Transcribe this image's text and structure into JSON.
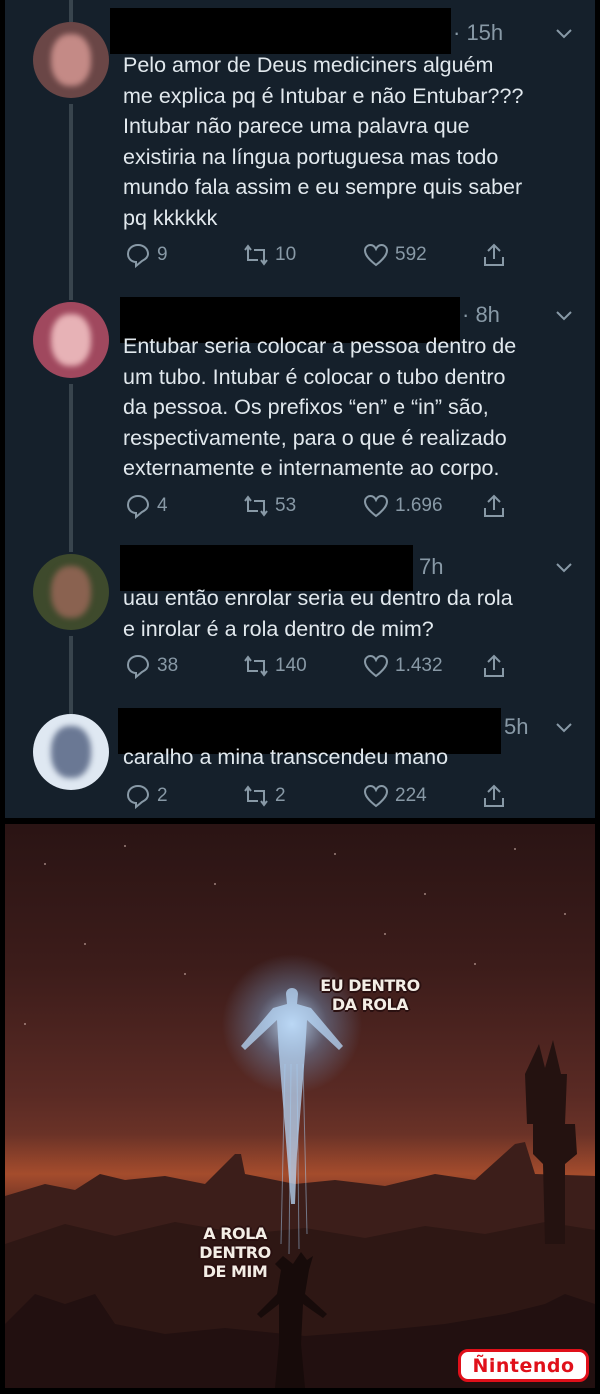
{
  "tweets": [
    {
      "time": "· 15h",
      "text": "Pelo amor de Deus mediciners alguém\nme explica pq é Intubar e não Entubar???\nIntubar não parece uma palavra que\nexistiria na língua portuguesa mas todo\nmundo fala assim e eu sempre quis saber\npq kkkkkk",
      "replies": "9",
      "retweets": "10",
      "likes": "592",
      "avatar_color": "#b07a78"
    },
    {
      "time": "· 8h",
      "text": "Entubar seria colocar a pessoa dentro de\num tubo. Intubar é colocar o tubo dentro\nda pessoa. Os prefixos “en” e “in” são,\nrespectivamente, para o que é realizado\nexternamente e internamente ao corpo.",
      "replies": "4",
      "retweets": "53",
      "likes": "1.696",
      "avatar_color": "#c6788a"
    },
    {
      "time": "7h",
      "text": "uau então enrolar seria eu dentro da rola\ne inrolar é a rola dentro de mim?",
      "replies": "38",
      "retweets": "140",
      "likes": "1.432",
      "avatar_color": "#6f7a48"
    },
    {
      "time": "5h",
      "text": "caralho a mina transcendeu mano",
      "replies": "2",
      "retweets": "2",
      "likes": "224",
      "avatar_color": "#9fb0c8"
    }
  ],
  "meme": {
    "caption_top": "EU DENTRO\nDA ROLA",
    "caption_bottom": "A ROLA\nDENTRO\nDE MIM",
    "watermark": "Ñintendo"
  }
}
